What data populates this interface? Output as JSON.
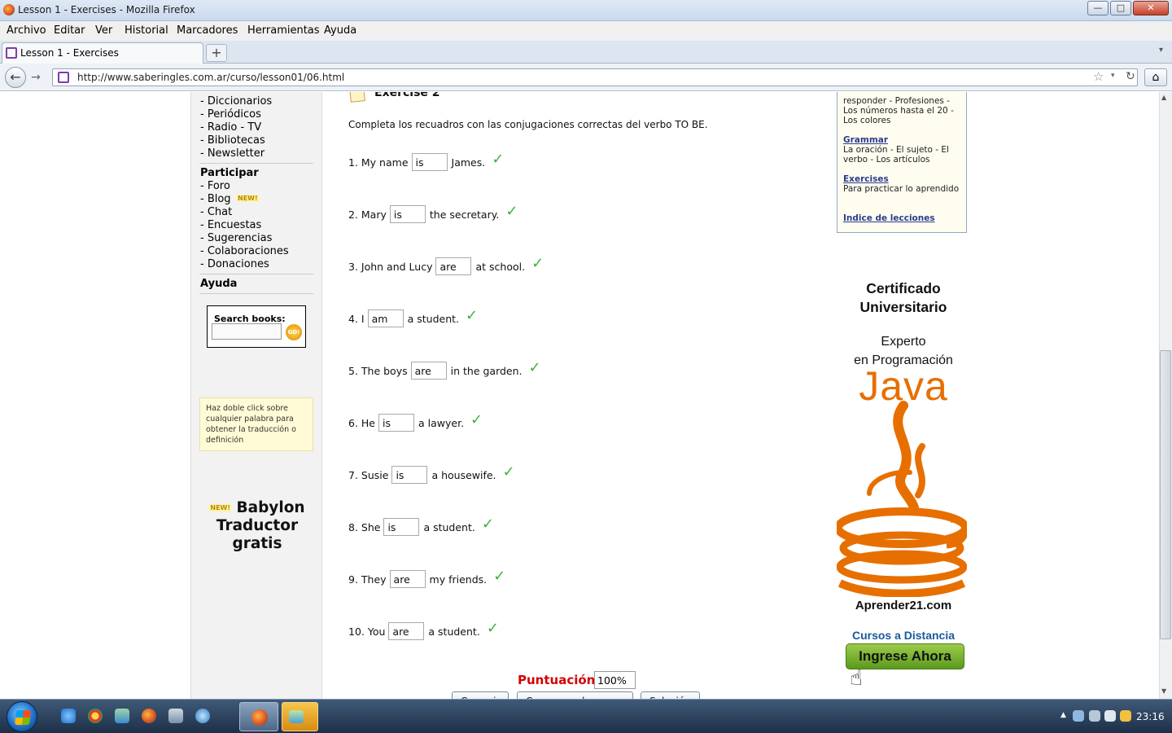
{
  "window": {
    "title": "Lesson 1 - Exercises - Mozilla Firefox",
    "min_glyph": "—",
    "max_glyph": "□",
    "close_glyph": "✕"
  },
  "menu": {
    "items": [
      "Archivo",
      "Editar",
      "Ver",
      "Historial",
      "Marcadores",
      "Herramientas",
      "Ayuda"
    ]
  },
  "tabs": [
    {
      "label": "Lesson 1 - Exercises",
      "icon": "book-icon"
    }
  ],
  "newtab_glyph": "+",
  "overflow_glyph": "▾",
  "nav": {
    "back_glyph": "←",
    "forward_glyph": "→",
    "url": "http://www.saberingles.com.ar/curso/lesson01/06.html",
    "star_glyph": "☆",
    "drop_glyph": "▾",
    "reload_glyph": "↻",
    "home_glyph": "⌂"
  },
  "sidebar": {
    "top_links": [
      "Diccionarios",
      "Periódicos",
      "Radio  -  TV",
      "Bibliotecas",
      "Newsletter"
    ],
    "participar_heading": "Participar",
    "participar_links": [
      "Foro",
      "Blog",
      "Chat",
      "Encuestas",
      "Sugerencias",
      "Colaboraciones",
      "Donaciones"
    ],
    "new_badge": "NEW!",
    "ayuda_heading": "Ayuda",
    "search_label": "Search books:",
    "search_go": "GO!",
    "tip": "Haz doble click sobre cualquier palabra para obtener la traducción o definición",
    "babylon_new": "NEW!",
    "babylon_line1": "Babylon",
    "babylon_line2": "Traductor",
    "babylon_line3": "gratis"
  },
  "exercise": {
    "title": "Exercise 2",
    "instructions": "Completa los recuadros con las conjugaciones correctas del verbo TO BE.",
    "check_glyph": "✓",
    "questions": [
      {
        "before": "1. My name",
        "answer": "is",
        "after": "James."
      },
      {
        "before": "2. Mary",
        "answer": "is",
        "after": "the secretary."
      },
      {
        "before": "3. John and Lucy",
        "answer": "are",
        "after": "at school."
      },
      {
        "before": "4. I",
        "answer": "am",
        "after": "a student."
      },
      {
        "before": "5. The boys",
        "answer": "are",
        "after": "in the garden."
      },
      {
        "before": "6. He",
        "answer": "is",
        "after": "a lawyer."
      },
      {
        "before": "7. Susie",
        "answer": "is",
        "after": "a housewife."
      },
      {
        "before": "8. She",
        "answer": "is",
        "after": "a student."
      },
      {
        "before": "9. They",
        "answer": "are",
        "after": "my friends."
      },
      {
        "before": "10. You",
        "answer": "are",
        "after": "a student."
      }
    ],
    "score_label": "Puntuación:",
    "score_value": "100%",
    "buttons": [
      "Corregir",
      "Comenzar de nuevo",
      "Solución"
    ]
  },
  "lesson_box": {
    "intro": "responder - Profesiones - Los números hasta el 20 - Los colores",
    "grammar_link": "Grammar",
    "grammar_desc": "La oración - El sujeto - El verbo - Los artículos",
    "exercises_link": "Exercises",
    "exercises_desc": "Para practicar lo aprendido",
    "index_link": "Indice de lecciones"
  },
  "ad": {
    "cert_line1": "Certificado",
    "cert_line2": "Universitario",
    "exp_line1": "Experto",
    "exp_line2": "en Programación",
    "java": "Java",
    "site": "Aprender21.com",
    "cursos": "Cursos a Distancia",
    "cta": "Ingrese Ahora",
    "hand_glyph": "☝"
  },
  "taskbar": {
    "clock": "23:16",
    "tray_arrow": "▲",
    "icons": [
      "ie-icon",
      "chrome-icon",
      "network-icon",
      "firefox-icon",
      "box-icon",
      "globe-icon"
    ]
  },
  "colors": {
    "accent_red": "#d40000",
    "check_green": "#3cb33c",
    "java_orange": "#e76f00"
  }
}
